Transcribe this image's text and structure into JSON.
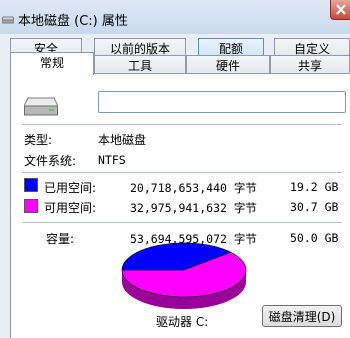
{
  "window": {
    "title": "本地磁盘 (C:) 属性"
  },
  "tabs": {
    "row_back": [
      "安全",
      "以前的版本",
      "配额",
      "自定义"
    ],
    "row_front": [
      "常规",
      "工具",
      "硬件",
      "共享"
    ],
    "active": "常规",
    "hovered": "配额"
  },
  "general": {
    "name_value": "",
    "type_label": "类型:",
    "type_value": "本地磁盘",
    "fs_label": "文件系统:",
    "fs_value": "NTFS",
    "used": {
      "label": "已用空间:",
      "bytes": "20,718,653,440 字节",
      "size": "19.2 GB",
      "color": "#0000ff"
    },
    "free": {
      "label": "可用空间:",
      "bytes": "32,975,941,632 字节",
      "size": "30.7 GB",
      "color": "#ff00ff"
    },
    "capacity": {
      "label": "容量:",
      "bytes": "53,694,595,072 字节",
      "size": "50.0 GB"
    },
    "drive_label": "驱动器 C:",
    "cleanup_button": "磁盘清理(D)",
    "used_fraction": 0.386
  }
}
